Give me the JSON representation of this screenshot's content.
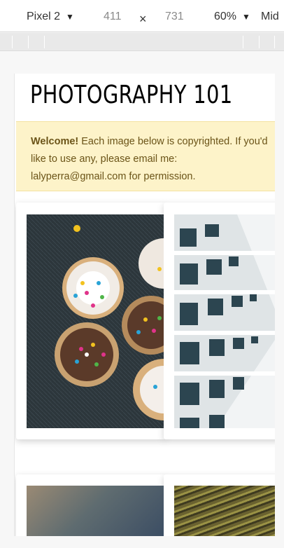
{
  "devtools": {
    "device_name": "Pixel 2",
    "width_value": "411",
    "times_symbol": "×",
    "height_value": "731",
    "zoom": "60%",
    "throttle_label": "Mid"
  },
  "page": {
    "title": "PHOTOGRAPHY 101",
    "welcome_bold": "Welcome!",
    "welcome_text": " Each image below is copyrighted. If you'd like to use any, please email me: lalyperra@gmail.com for permission."
  },
  "icons": [
    "caret-down-icon"
  ],
  "colors": {
    "welcome_bg": "#fdf3c9",
    "welcome_text": "#6b5418"
  }
}
